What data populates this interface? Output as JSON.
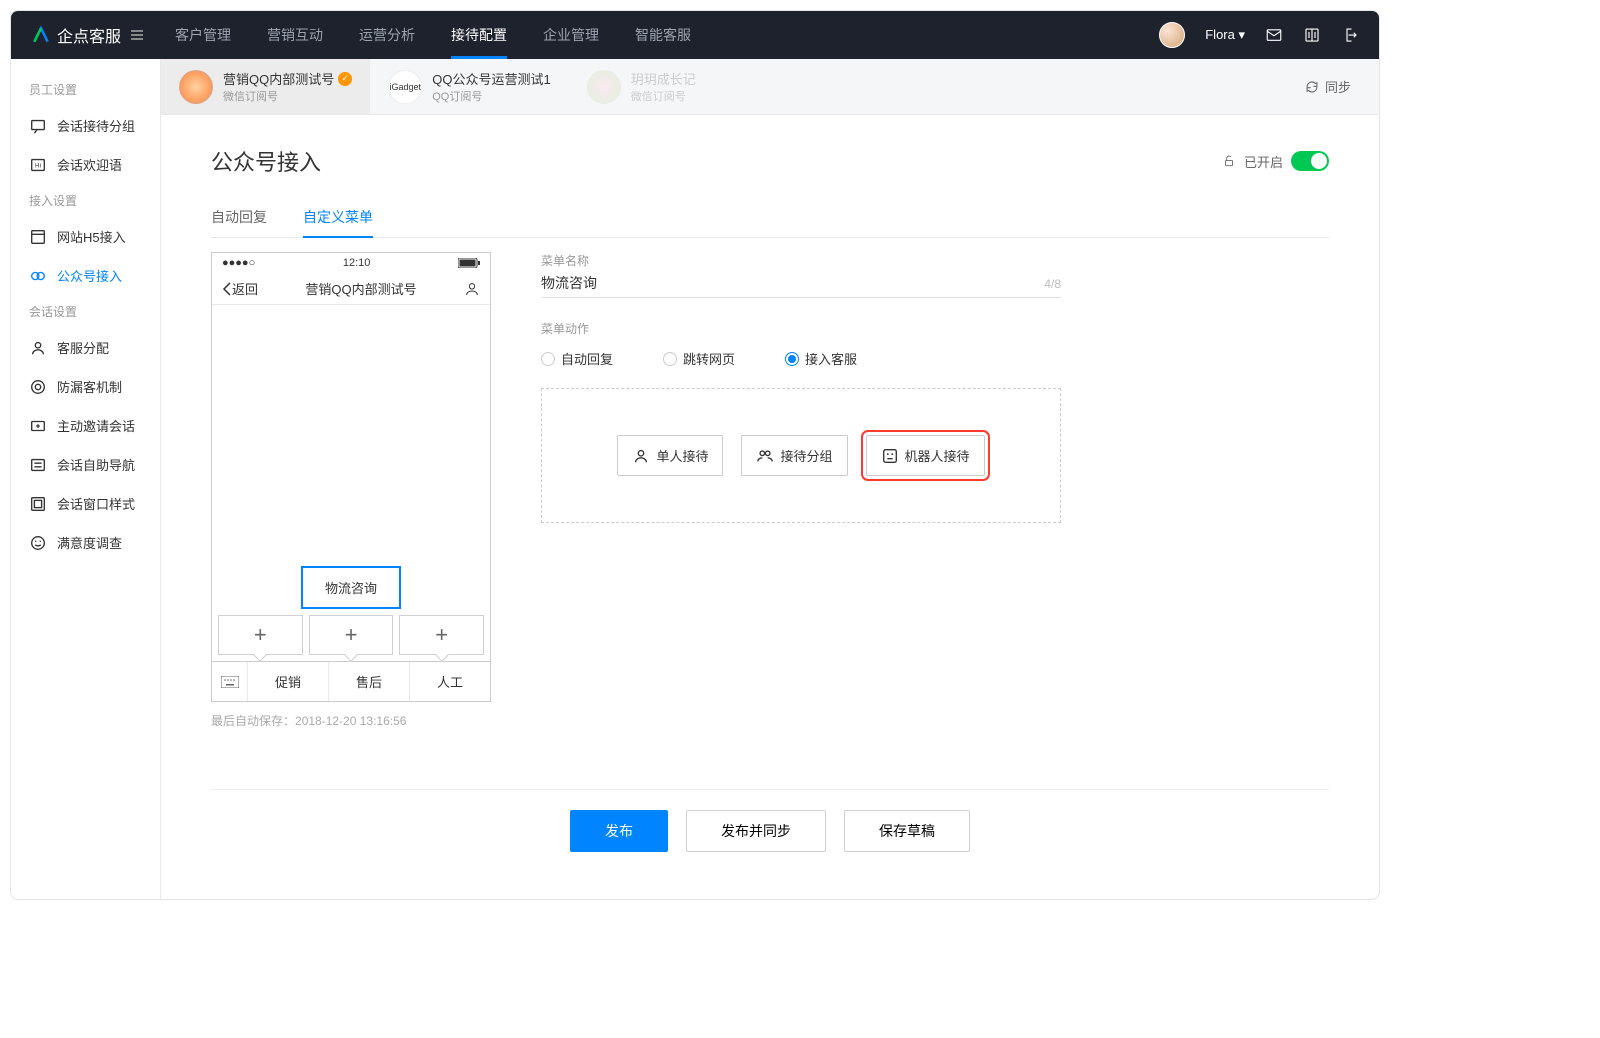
{
  "header": {
    "product_name": "企点客服",
    "nav": [
      "客户管理",
      "营销互动",
      "运营分析",
      "接待配置",
      "企业管理",
      "智能客服"
    ],
    "active_nav_index": 3,
    "user_name": "Flora"
  },
  "sidebar": {
    "sections": [
      {
        "title": "员工设置",
        "items": [
          {
            "label": "会话接待分组"
          },
          {
            "label": "会话欢迎语"
          }
        ]
      },
      {
        "title": "接入设置",
        "items": [
          {
            "label": "网站H5接入"
          },
          {
            "label": "公众号接入",
            "active": true
          }
        ]
      },
      {
        "title": "会话设置",
        "items": [
          {
            "label": "客服分配"
          },
          {
            "label": "防漏客机制"
          },
          {
            "label": "主动邀请会话"
          },
          {
            "label": "会话自助导航"
          },
          {
            "label": "会话窗口样式"
          },
          {
            "label": "满意度调查"
          }
        ]
      }
    ]
  },
  "account_tabs": [
    {
      "title": "营销QQ内部测试号",
      "sub": "微信订阅号",
      "verified": true,
      "active": true
    },
    {
      "title": "QQ公众号运营测试1",
      "sub": "QQ订阅号",
      "icon_label": "iGadget"
    },
    {
      "title": "玥玥成长记",
      "sub": "微信订阅号",
      "faded": true
    }
  ],
  "sync_label": "同步",
  "page": {
    "title": "公众号接入",
    "enabled_label": "已开启",
    "sub_tabs": [
      "自动回复",
      "自定义菜单"
    ],
    "active_sub_tab_index": 1
  },
  "phone": {
    "time": "12:10",
    "back_label": "返回",
    "header_title": "营销QQ内部测试号",
    "submenu_item": "物流咨询",
    "bottom_menu": [
      "促销",
      "售后",
      "人工"
    ]
  },
  "autosave": {
    "prefix": "最后自动保存：",
    "timestamp": "2018-12-20 13:16:56"
  },
  "form": {
    "name_label": "菜单名称",
    "name_value": "物流咨询",
    "char_count": "4/8",
    "action_label": "菜单动作",
    "radios": [
      "自动回复",
      "跳转网页",
      "接入客服"
    ],
    "checked_radio_index": 2,
    "options": [
      "单人接待",
      "接待分组",
      "机器人接待"
    ],
    "highlighted_option_index": 2
  },
  "footer": {
    "publish": "发布",
    "publish_sync": "发布并同步",
    "save_draft": "保存草稿"
  }
}
